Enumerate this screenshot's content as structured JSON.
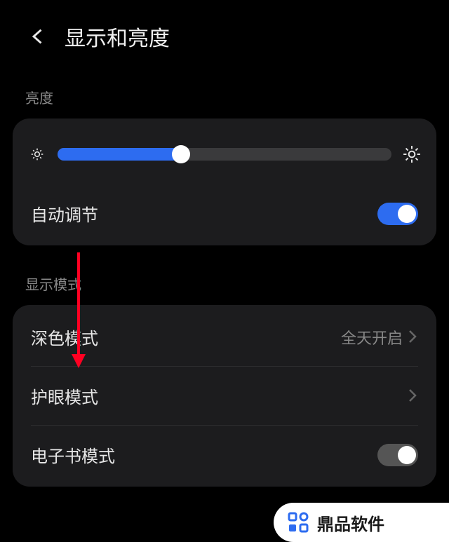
{
  "header": {
    "title": "显示和亮度"
  },
  "brightness": {
    "section_label": "亮度",
    "slider_percent": 37,
    "auto_label": "自动调节",
    "auto_on": true
  },
  "display_mode": {
    "section_label": "显示模式",
    "dark_mode": {
      "label": "深色模式",
      "value": "全天开启"
    },
    "eye_comfort": {
      "label": "护眼模式"
    },
    "ebook": {
      "label": "电子书模式",
      "on": false
    }
  },
  "watermark": {
    "text": "鼎品软件"
  },
  "colors": {
    "accent": "#2d6cf0",
    "arrow": "#ff0022"
  }
}
